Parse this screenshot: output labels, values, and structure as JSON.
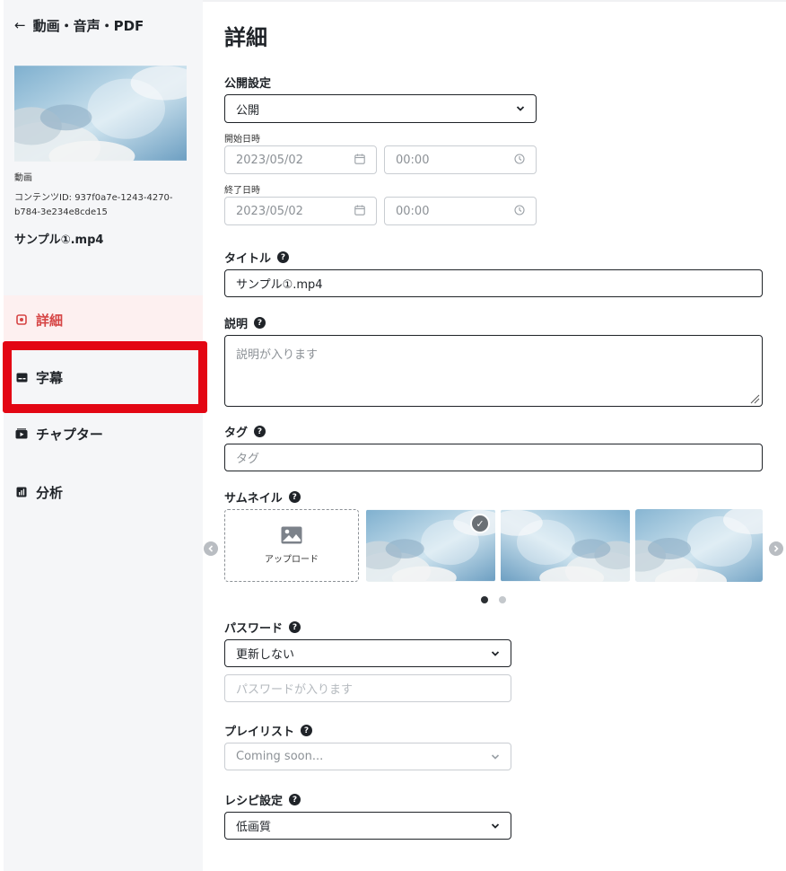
{
  "sidebar": {
    "back_label": "動画・音声・PDF",
    "media_type": "動画",
    "content_id": "コンテンツID: 937f0a7e-1243-4270-b784-3e234e8cde15",
    "filename": "サンプル①.mp4",
    "nav": [
      {
        "label": "詳細",
        "icon": "gear-icon",
        "active": true
      },
      {
        "label": "字幕",
        "icon": "subtitles-icon",
        "active": false
      },
      {
        "label": "チャプター",
        "icon": "play-icon",
        "active": false
      },
      {
        "label": "分析",
        "icon": "analytics-icon",
        "active": false
      }
    ]
  },
  "main": {
    "title": "詳細",
    "visibility": {
      "label": "公開設定",
      "value": "公開"
    },
    "start": {
      "label": "開始日時",
      "date_placeholder": "2023/05/02",
      "time_placeholder": "00:00"
    },
    "end": {
      "label": "終了日時",
      "date_placeholder": "2023/05/02",
      "time_placeholder": "00:00"
    },
    "title_field": {
      "label": "タイトル",
      "value": "サンプル①.mp4"
    },
    "description": {
      "label": "説明",
      "placeholder": "説明が入ります"
    },
    "tags": {
      "label": "タグ",
      "placeholder": "タグ"
    },
    "thumbnail": {
      "label": "サムネイル",
      "upload_label": "アップロード",
      "selected_index": 0
    },
    "password": {
      "label": "パスワード",
      "value": "更新しない",
      "placeholder": "パスワードが入ります"
    },
    "playlist": {
      "label": "プレイリスト",
      "placeholder": "Coming soon..."
    },
    "recipe": {
      "label": "レシピ設定",
      "value": "低画質"
    }
  },
  "colors": {
    "accent": "#d64545",
    "highlight": "#e30613",
    "sidebar_bg": "#f5f6f8"
  }
}
